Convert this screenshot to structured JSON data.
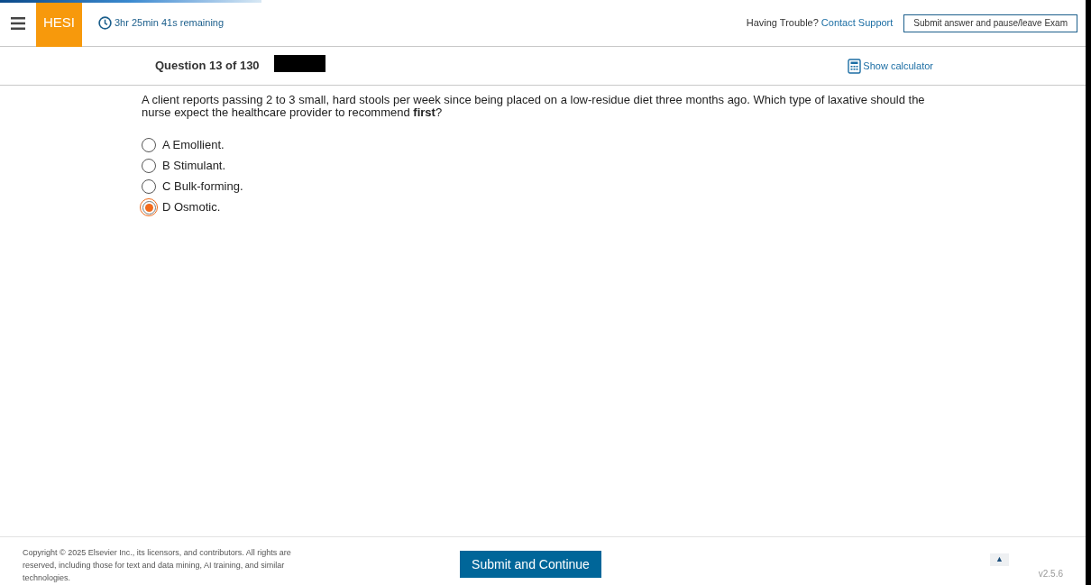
{
  "header": {
    "logo": "HESI",
    "timer": "3hr 25min 41s remaining",
    "help_text": "Having Trouble?",
    "help_link": "Contact Support",
    "pause_button": "Submit answer and pause/leave Exam"
  },
  "question_bar": {
    "counter": "Question 13 of 130",
    "calculator": "Show calculator"
  },
  "question": {
    "stem": "A client reports passing 2 to 3 small, hard stools per week since being placed on a low-residue diet three months ago. Which type of laxative should the nurse expect the healthcare provider to recommend **first**?",
    "options": [
      {
        "label": "A Emollient.",
        "selected": false
      },
      {
        "label": "B Stimulant.",
        "selected": false
      },
      {
        "label": "C Bulk-forming.",
        "selected": false
      },
      {
        "label": "D Osmotic.",
        "selected": true
      }
    ]
  },
  "footer": {
    "copyright": "Copyright © 2025 Elsevier Inc., its licensors, and contributors. All rights are reserved, including those for text and data mining, AI training, and similar technologies.",
    "submit_button": "Submit and Continue",
    "top_button": "▲",
    "version": "v2.5.6"
  }
}
